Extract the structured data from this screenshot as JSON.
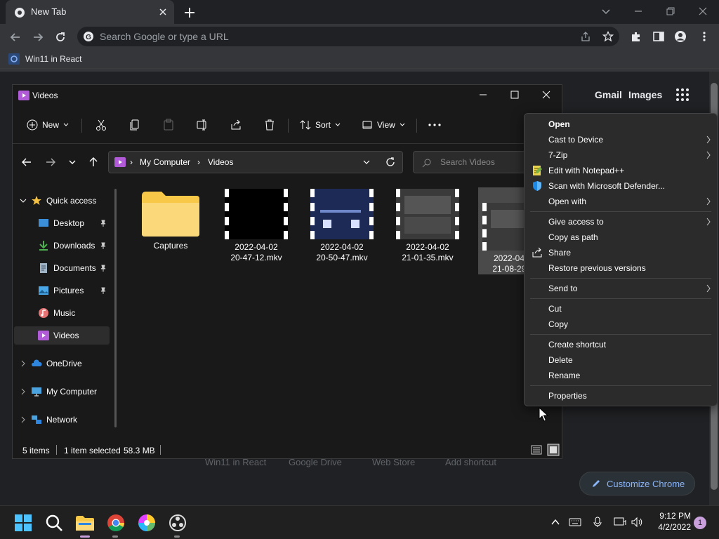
{
  "browser": {
    "tab_title": "New Tab",
    "omnibox_placeholder": "Search Google or type a URL",
    "bookmark": "Win11 in React"
  },
  "ntp": {
    "links": [
      "Gmail",
      "Images"
    ],
    "shortcuts": [
      "Win11 in React",
      "Google Drive",
      "Web Store",
      "Add shortcut"
    ],
    "customize": "Customize Chrome"
  },
  "explorer": {
    "title": "Videos",
    "toolbar": {
      "new": "New",
      "sort": "Sort",
      "view": "View"
    },
    "breadcrumb": [
      "My Computer",
      "Videos"
    ],
    "search_placeholder": "Search Videos",
    "sidebar": [
      {
        "label": "Quick access",
        "icon": "star-icon"
      },
      {
        "label": "Desktop",
        "icon": "desktop-icon",
        "pinned": true
      },
      {
        "label": "Downloads",
        "icon": "download-icon",
        "pinned": true
      },
      {
        "label": "Documents",
        "icon": "document-icon",
        "pinned": true
      },
      {
        "label": "Pictures",
        "icon": "pictures-icon",
        "pinned": true
      },
      {
        "label": "Music",
        "icon": "music-icon"
      },
      {
        "label": "Videos",
        "icon": "videos-icon",
        "selected": true
      },
      {
        "label": "OneDrive",
        "icon": "cloud-icon"
      },
      {
        "label": "My Computer",
        "icon": "computer-icon"
      },
      {
        "label": "Network",
        "icon": "network-icon"
      }
    ],
    "files": [
      {
        "name": "Captures",
        "type": "folder"
      },
      {
        "name": "2022-04-02\n20-47-12.mkv",
        "type": "video"
      },
      {
        "name": "2022-04-02\n20-50-47.mkv",
        "type": "video"
      },
      {
        "name": "2022-04-02\n21-01-35.mkv",
        "type": "video"
      },
      {
        "name": "2022-04-\n21-08-29.",
        "type": "video",
        "selected": true
      }
    ],
    "status": {
      "count": "5 items",
      "selected": "1 item selected",
      "size": "58.3 MB"
    }
  },
  "context_menu": [
    {
      "label": "Open",
      "bold": true
    },
    {
      "label": "Cast to Device",
      "submenu": true
    },
    {
      "label": "7-Zip",
      "submenu": true
    },
    {
      "label": "Edit with Notepad++",
      "icon": "notepad-icon"
    },
    {
      "label": "Scan with Microsoft Defender...",
      "icon": "defender-shield-icon"
    },
    {
      "label": "Open with",
      "submenu": true
    },
    {
      "sep": true
    },
    {
      "label": "Give access to",
      "submenu": true
    },
    {
      "label": "Copy as path"
    },
    {
      "label": "Share",
      "icon": "share-icon"
    },
    {
      "label": "Restore previous versions"
    },
    {
      "sep": true
    },
    {
      "label": "Send to",
      "submenu": true
    },
    {
      "sep": true
    },
    {
      "label": "Cut"
    },
    {
      "label": "Copy"
    },
    {
      "sep": true
    },
    {
      "label": "Create shortcut"
    },
    {
      "label": "Delete"
    },
    {
      "label": "Rename"
    },
    {
      "sep": true
    },
    {
      "label": "Properties"
    }
  ],
  "taskbar": {
    "time": "9:12 PM",
    "date": "4/2/2022",
    "notifications": "1"
  },
  "colors": {
    "accent": "#8ab4f8",
    "folder": "#f8d775",
    "video_icon": "#b15bd9"
  }
}
